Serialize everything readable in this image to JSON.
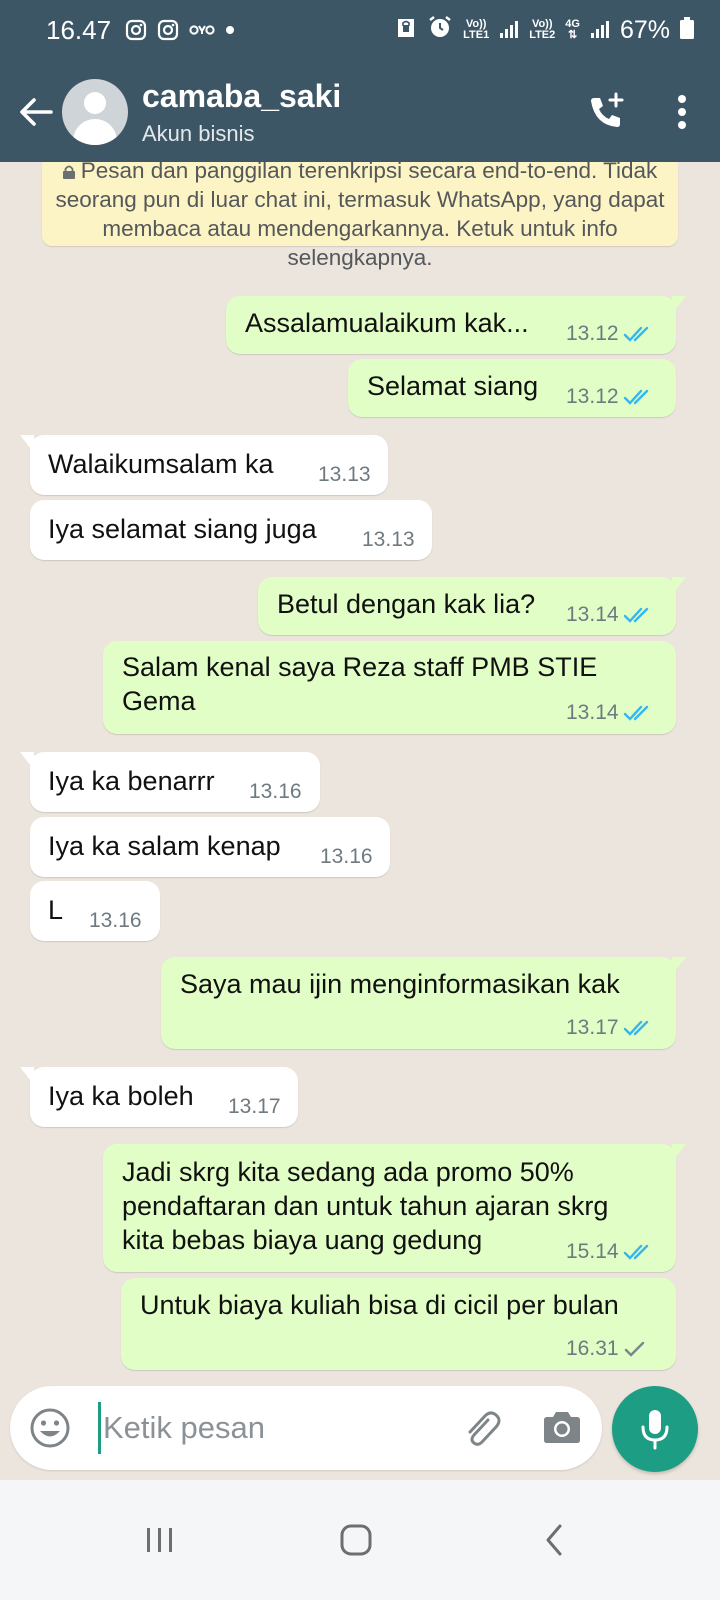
{
  "status_bar": {
    "time": "16.47",
    "battery": "67%",
    "net1": [
      "Vo))",
      "LTE1"
    ],
    "net2": [
      "Vo))",
      "LTE2"
    ],
    "net3": "4G"
  },
  "header": {
    "contact_name": "camaba_saki",
    "subtitle": "Akun bisnis"
  },
  "encryption_notice": "Pesan dan panggilan terenkripsi secara end-to-end. Tidak seorang pun di luar chat ini, termasuk WhatsApp, yang dapat membaca atau mendengarkannya. Ketuk untuk info selengkapnya.",
  "messages": [
    {
      "dir": "out",
      "lines": [
        "Assalamualaikum kak..."
      ],
      "time": "13.12",
      "status": "read"
    },
    {
      "dir": "out",
      "lines": [
        "Selamat siang"
      ],
      "time": "13.12",
      "status": "read"
    },
    {
      "dir": "in",
      "lines": [
        "Walaikumsalam ka"
      ],
      "time": "13.13"
    },
    {
      "dir": "in",
      "lines": [
        "Iya selamat siang juga"
      ],
      "time": "13.13"
    },
    {
      "dir": "out",
      "lines": [
        "Betul dengan kak lia?"
      ],
      "time": "13.14",
      "status": "read"
    },
    {
      "dir": "out",
      "lines": [
        "Salam kenal saya Reza staff PMB STIE",
        "Gema"
      ],
      "time": "13.14",
      "status": "read"
    },
    {
      "dir": "in",
      "lines": [
        "Iya ka benarrr"
      ],
      "time": "13.16"
    },
    {
      "dir": "in",
      "lines": [
        "Iya ka salam kenap"
      ],
      "time": "13.16"
    },
    {
      "dir": "in",
      "lines": [
        "L"
      ],
      "time": "13.16"
    },
    {
      "dir": "out",
      "lines": [
        "Saya mau ijin menginformasikan kak"
      ],
      "time": "13.17",
      "status": "read"
    },
    {
      "dir": "in",
      "lines": [
        "Iya ka boleh"
      ],
      "time": "13.17"
    },
    {
      "dir": "out",
      "lines": [
        "Jadi skrg kita sedang ada promo 50%",
        "pendaftaran dan untuk tahun ajaran skrg",
        "kita bebas biaya uang gedung"
      ],
      "time": "15.14",
      "status": "read"
    },
    {
      "dir": "out",
      "lines": [
        "Untuk biaya kuliah bisa di cicil per bulan"
      ],
      "time": "16.31",
      "status": "sent"
    }
  ],
  "composer": {
    "placeholder": "Ketik pesan"
  },
  "colors": {
    "header": "#3d5666",
    "outgoing_bubble": "#e1fec6",
    "incoming_bubble": "#ffffff",
    "chat_background": "#ece5dd",
    "read_tick": "#34b7f1",
    "accent": "#1c9d84",
    "notice": "#fdf4c5"
  },
  "icons": {
    "back": "arrow-left-icon",
    "add_call": "phone-plus-icon",
    "menu": "more-vertical-icon",
    "emoji": "smiley-icon",
    "attach": "paperclip-icon",
    "camera": "camera-icon",
    "mic": "microphone-icon"
  }
}
